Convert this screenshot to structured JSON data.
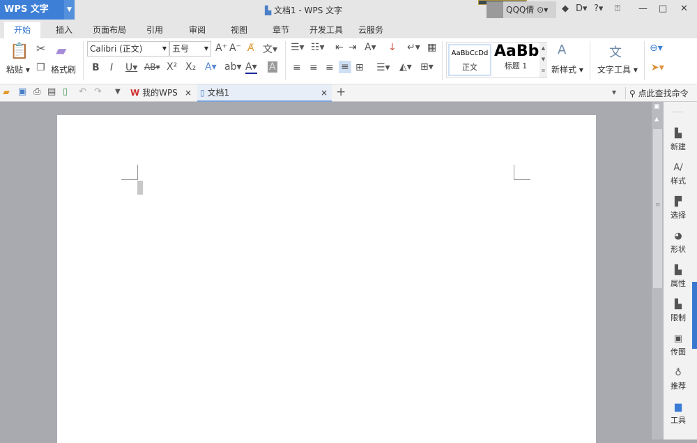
{
  "app": {
    "logo": "WPS 文字",
    "title": "文档1 - WPS 文字",
    "user": "QQQ倩"
  },
  "menu_tabs": [
    "开始",
    "插入",
    "页面布局",
    "引用",
    "审阅",
    "视图",
    "章节",
    "开发工具",
    "云服务"
  ],
  "ribbon": {
    "paste": "粘贴",
    "format_painter": "格式刷",
    "font": "Calibri (正文)",
    "size": "五号",
    "style_normal_preview": "AaBbCcDd",
    "style_normal": "正文",
    "style_h1_preview": "AaBb",
    "style_h1": "标题 1",
    "new_style": "新样式",
    "text_tools": "文字工具"
  },
  "doc_tabs": [
    {
      "label": "我的WPS"
    },
    {
      "label": "文档1"
    }
  ],
  "search_command": "点此查找命令",
  "side_panel": [
    "新建",
    "样式",
    "选择",
    "形状",
    "属性",
    "限制",
    "传图",
    "推荐",
    "工具"
  ],
  "colors": {
    "accent": "#3d7fd6"
  }
}
